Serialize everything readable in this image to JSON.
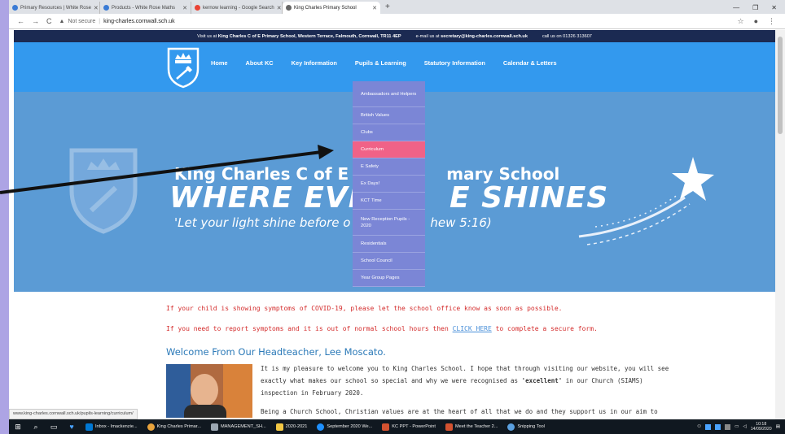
{
  "browser": {
    "tabs": [
      {
        "title": "Primary Resources | White Rose",
        "color": "#3a7bd5"
      },
      {
        "title": "Products - White Rose Maths",
        "color": "#3a7bd5"
      },
      {
        "title": "kernow learning - Google Search",
        "color": "#ea4335"
      },
      {
        "title": "King Charles Primary School",
        "color": "#666666"
      }
    ],
    "new_tab": "+",
    "security": "Not secure",
    "url": "king-charles.cornwall.sch.uk",
    "status_url": "www.king-charles.cornwall.sch.uk/pupils-learning/curriculum/"
  },
  "site": {
    "top_info": {
      "visit_prefix": "Visit us at",
      "visit_bold": "King Charles C of E Primary School, Western Terrace, Falmouth, Cornwall, TR11 4EP",
      "email_prefix": "e-mail us at",
      "email_bold": "secretary@king-charles.cornwall.sch.uk",
      "call": "call us on 01326 313607"
    },
    "nav": [
      "Home",
      "About KC",
      "Key Information",
      "Pupils & Learning",
      "Statutory Information",
      "Calendar & Letters"
    ],
    "hero": {
      "line1": "King Charles C of E (",
      "line1b": "mary School",
      "line2": "WHERE EVER",
      "line2b": "E SHINES",
      "line3": "'Let your light shine before o",
      "line3b": "hew 5:16)"
    },
    "dropdown": [
      "Ambassadors and Helpers",
      "British Values",
      "Clubs",
      "Curriculum",
      "E Safety",
      "Ex Days!",
      "KCT Time",
      "New Reception Pupils - 2020",
      "Residentials",
      "School Council",
      "Year Group Pages"
    ],
    "dropdown_active": "Curriculum",
    "covid_notice": "If your child is showing symptoms of COVID-19, please let the school office know as soon as possible.",
    "report_pre": "If you need to report symptoms and it is out of normal school hours then",
    "report_link": "CLICK HERE",
    "report_post": "to complete a secure form.",
    "welcome_title": "Welcome From Our Headteacher, Lee Moscato.",
    "para1_l1": "It is my pleasure to welcome you to King Charles School. I hope that through visiting our website, you will see",
    "para1_l2a": "exactly what makes our school so special and why we were recognised as",
    "para1_l2b": "'excellent'",
    "para1_l2c": "in our Church (SIAMS)",
    "para1_l3": "inspection in February 2020.",
    "para2_l1": "Being a Church School, Christian values are at the heart of all that we do and they support us in our aim to"
  },
  "taskbar": {
    "items": [
      {
        "label": "Inbox - Imackenzie...",
        "color": "#0078d4"
      },
      {
        "label": "King Charles Primar...",
        "color": "#e8a33c"
      },
      {
        "label": "MANAGEMENT_SH...",
        "color": "#9aa6b2"
      },
      {
        "label": "2020-2021",
        "color": "#f2c744"
      },
      {
        "label": "September 2020 We...",
        "color": "#1e90ff"
      },
      {
        "label": "KC PPT - PowerPoint",
        "color": "#d35230"
      },
      {
        "label": "Meet the Teacher 2...",
        "color": "#d35230"
      },
      {
        "label": "Snipping Tool",
        "color": "#5aa0e0"
      }
    ],
    "time": "10:18",
    "date": "14/09/2020"
  },
  "colors": {
    "nav_bg": "#3399ee",
    "top_bar": "#1b2a52",
    "hero_bg": "#5b9bd5",
    "dropdown_bg": "#7b86d6",
    "dropdown_active": "#f06287"
  }
}
